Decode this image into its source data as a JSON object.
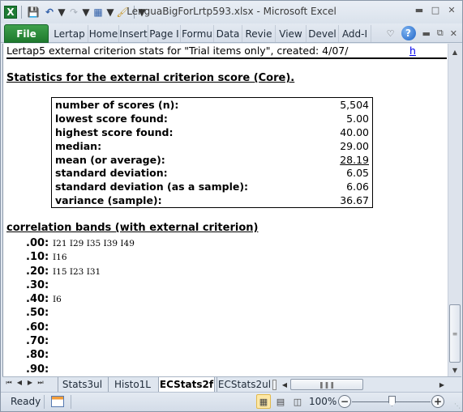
{
  "window": {
    "title": "LenguaBigForLrtp593.xlsx  -  Microsoft Excel"
  },
  "quick_access": {
    "icons": [
      "excel-logo-icon",
      "save-icon",
      "undo-icon",
      "redo-icon",
      "form-icon",
      "format-painter-icon",
      "customize-qat-icon"
    ]
  },
  "ribbon": {
    "file_label": "File",
    "tabs": [
      {
        "label": "Lertap"
      },
      {
        "label": "Home"
      },
      {
        "label": "Insert"
      },
      {
        "label": "Page I"
      },
      {
        "label": "Formu"
      },
      {
        "label": "Data"
      },
      {
        "label": "Revie"
      },
      {
        "label": "View"
      },
      {
        "label": "Devel"
      },
      {
        "label": "Add-I"
      }
    ]
  },
  "sheet": {
    "row1_text": "Lertap5 external criterion stats for \"Trial items only\", created: 4/07/",
    "row1_link": "h",
    "heading": "Statistics for the external criterion score (Core).",
    "stats": [
      {
        "label": "number of scores (n):",
        "value": "5,504"
      },
      {
        "label": "lowest score found:",
        "value": "5.00"
      },
      {
        "label": "highest score found:",
        "value": "40.00"
      },
      {
        "label": "median:",
        "value": "29.00"
      },
      {
        "label": "mean (or average):",
        "value": "28.19"
      },
      {
        "label": "standard deviation:",
        "value": "6.05"
      },
      {
        "label": "standard deviation (as a sample):",
        "value": "6.06"
      },
      {
        "label": "variance (sample):",
        "value": "36.67"
      }
    ],
    "corr_heading": "correlation bands (with external criterion)",
    "bands": [
      {
        "label": ".00:",
        "items": "I21 I29 I35 I39 I49"
      },
      {
        "label": ".10:",
        "items": "I16"
      },
      {
        "label": ".20:",
        "items": "I15 I23 I31"
      },
      {
        "label": ".30:",
        "items": ""
      },
      {
        "label": ".40:",
        "items": "I6"
      },
      {
        "label": ".50:",
        "items": ""
      },
      {
        "label": ".60:",
        "items": ""
      },
      {
        "label": ".70:",
        "items": ""
      },
      {
        "label": ".80:",
        "items": ""
      },
      {
        "label": ".90:",
        "items": ""
      }
    ]
  },
  "sheet_tabs": {
    "tabs": [
      {
        "label": "Stats3ul",
        "active": false
      },
      {
        "label": "Histo1L",
        "active": false
      },
      {
        "label": "ECStats2f",
        "active": true
      },
      {
        "label": "ECStats2ul",
        "active": false
      }
    ]
  },
  "status_bar": {
    "status": "Ready",
    "zoom": "100%",
    "zoom_level_percent": 100
  }
}
